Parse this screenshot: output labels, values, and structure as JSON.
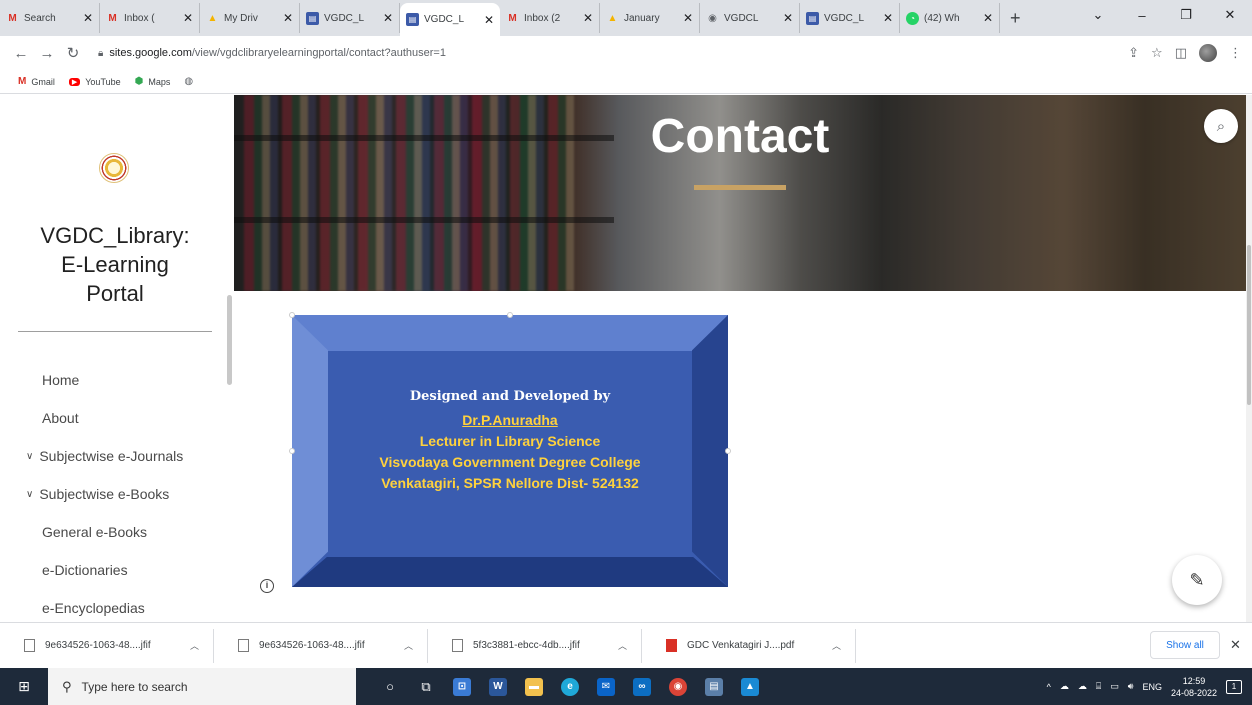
{
  "browser": {
    "tabs": [
      {
        "label": "Search",
        "icon": "gmail-icon",
        "active": false
      },
      {
        "label": "Inbox (",
        "icon": "gmail-icon",
        "active": false
      },
      {
        "label": "My Driv",
        "icon": "drive-icon",
        "active": false
      },
      {
        "label": "VGDC_L",
        "icon": "sites-icon",
        "active": false
      },
      {
        "label": "VGDC_L",
        "icon": "sites-icon",
        "active": true
      },
      {
        "label": "Inbox (2",
        "icon": "gmail-icon",
        "active": false
      },
      {
        "label": "January",
        "icon": "drive-icon",
        "active": false
      },
      {
        "label": "VGDCL",
        "icon": "chrome-icon",
        "active": false
      },
      {
        "label": "VGDC_L",
        "icon": "sites-icon",
        "active": false
      },
      {
        "label": "(42) Wh",
        "icon": "whatsapp-icon",
        "active": false
      }
    ],
    "new_tab": "+",
    "window_controls": {
      "tab_search": "⌄",
      "minimize": "–",
      "restore": "❐",
      "close": "✕"
    },
    "url_host": "sites.google.com",
    "url_path": "/view/vgdclibraryelearningportal/contact?authuser=1",
    "bookmarks": [
      {
        "label": "Gmail",
        "icon": "gmail-icon"
      },
      {
        "label": "YouTube",
        "icon": "youtube-icon"
      },
      {
        "label": "Maps",
        "icon": "maps-icon"
      }
    ]
  },
  "site": {
    "title_line1": "VGDC_Library:",
    "title_line2": "E-Learning",
    "title_line3": "Portal",
    "nav": [
      {
        "label": "Home",
        "caret": false
      },
      {
        "label": "About",
        "caret": false
      },
      {
        "label": "Subjectwise e-Journals",
        "caret": true
      },
      {
        "label": "Subjectwise e-Books",
        "caret": true
      },
      {
        "label": "General e-Books",
        "caret": false
      },
      {
        "label": "e-Dictionaries",
        "caret": false
      },
      {
        "label": "e-Encyclopedias",
        "caret": false
      }
    ],
    "hero_title": "Contact",
    "banner": {
      "line1": "Designed and Developed  by",
      "line2": "Dr.P.Anuradha",
      "line3": "Lecturer in Library Science",
      "line4": "Visvodaya Government Degree College",
      "line5": "Venkatagiri, SPSR Nellore Dist- 524132"
    }
  },
  "downloads": {
    "items": [
      {
        "name": "9e634526-1063-48....jfif",
        "type": "jfif"
      },
      {
        "name": "9e634526-1063-48....jfif",
        "type": "jfif"
      },
      {
        "name": "5f3c3881-ebcc-4db....jfif",
        "type": "jfif"
      },
      {
        "name": "GDC Venkatagiri J....pdf",
        "type": "pdf"
      }
    ],
    "show_all": "Show all"
  },
  "taskbar": {
    "search_placeholder": "Type here to search",
    "language": "ENG",
    "time": "12:59",
    "date": "24-08-2022",
    "notification_count": "1"
  }
}
